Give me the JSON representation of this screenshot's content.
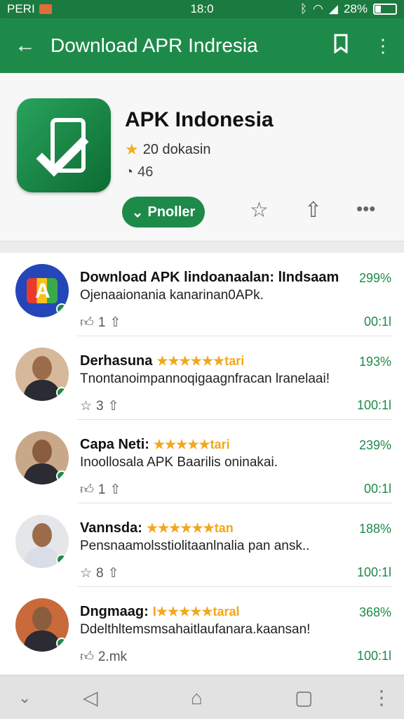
{
  "status": {
    "carrier": "PERI",
    "time": "18:0",
    "battery": "28%",
    "icons": [
      "carrier-badge-icon",
      "bluetooth-icon",
      "wifi-icon",
      "signal-icon",
      "battery-icon"
    ]
  },
  "appbar": {
    "title": "Download APR Indresia",
    "icons": [
      "back-arrow-icon",
      "bookmark-icon",
      "more-vert-icon"
    ]
  },
  "app": {
    "name": "APK Indonesia",
    "rating_text": "20 dokasin",
    "downloads_text": "46",
    "install_label": "Pnoller",
    "actions": [
      "star-icon",
      "share-icon",
      "more-horiz-icon"
    ]
  },
  "reviews": [
    {
      "name": "Download APK lindoanaalan: lIndsaam",
      "stars": "",
      "text": "Ojenaaionania kanarinan0APk.",
      "likes": "1",
      "percent": "299%",
      "meta": "00:1l"
    },
    {
      "name": "Derhasuna",
      "stars": "★★★★★★tari",
      "text": "Tnontanoimpannoqigaagnfracan lranelaai!",
      "likes": "3",
      "percent": "193%",
      "meta": "100:1l"
    },
    {
      "name": "Capa Neti:",
      "stars": "★★★★★tari",
      "text": "Inoollosala APK Baarilis oninakai.",
      "likes": "1",
      "percent": "239%",
      "meta": "00:1l"
    },
    {
      "name": "Vannsda:",
      "stars": "★★★★★★tan",
      "text": "Pensnaamolsstiolitaanlnalia pan ansk..",
      "likes": "8",
      "percent": "188%",
      "meta": "100:1l"
    },
    {
      "name": "Dngmaag:",
      "stars": "I★★★★★taral",
      "text": "Ddelthltemsmsahaitlaufanara.kaansan!",
      "likes": "2.mk",
      "percent": "368%",
      "meta": "100:1l"
    }
  ],
  "colors": {
    "primary": "#1e8a4a",
    "star": "#f2b01e"
  }
}
